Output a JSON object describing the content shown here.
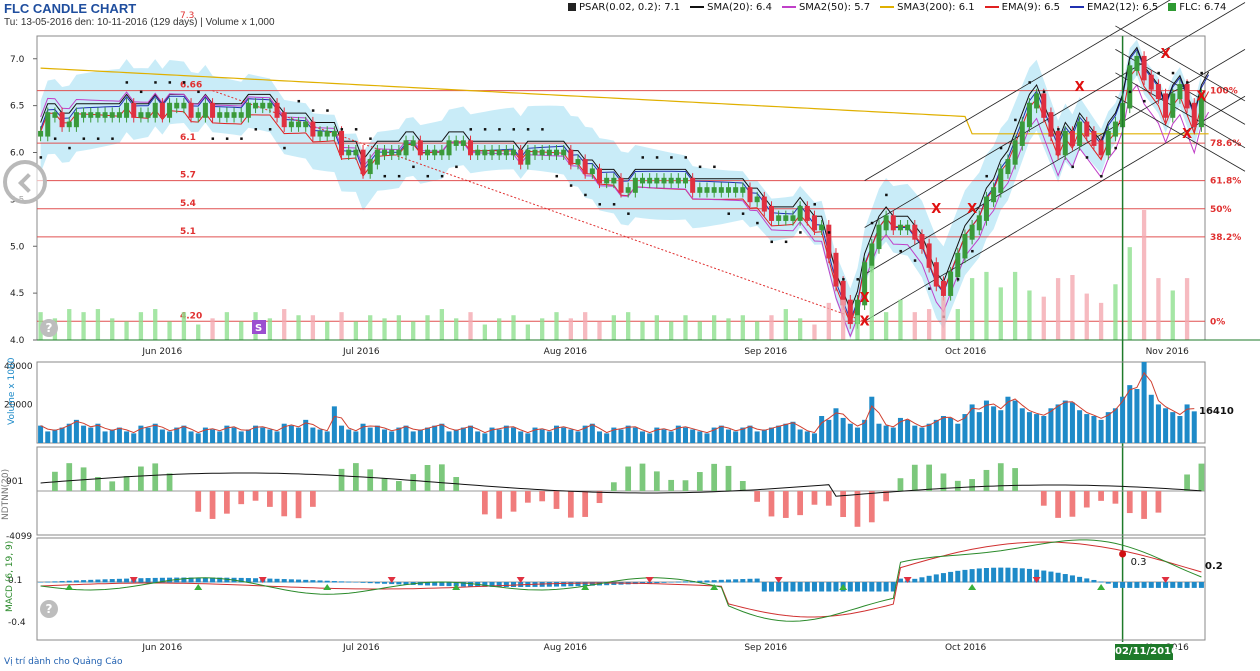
{
  "header": {
    "title": "FLC CANDLE CHART",
    "subtitle": "Tu: 13-05-2016 den: 10-11-2016 (129 days) | Volume x 1,000"
  },
  "legend": [
    {
      "label": "PSAR(0.02, 0.2): 7.1",
      "color": "#222222"
    },
    {
      "label": "SMA(20): 6.4",
      "color": "#111111"
    },
    {
      "label": "SMA2(50): 5.7",
      "color": "#c040c8"
    },
    {
      "label": "SMA3(200): 6.1",
      "color": "#e0b000"
    },
    {
      "label": "EMA(9): 6.5",
      "color": "#e02020"
    },
    {
      "label": "EMA2(12): 6.5",
      "color": "#2030b0"
    },
    {
      "label": "FLC: 6.74",
      "color": "#2e9a32"
    }
  ],
  "footer": "Vị trí dành cho Quảng Cáo",
  "cursor_date": "02/11/2016",
  "icons": {
    "nav": "chevron-left-icon",
    "help": "help-icon",
    "signal": "S"
  },
  "colors": {
    "up": "#3a9a3a",
    "down": "#e03040",
    "cloud": "#bfe9f7",
    "volume": "#1e8ac8"
  },
  "chart_data": [
    {
      "type": "candlestick",
      "title": "FLC CANDLE CHART",
      "ylim": [
        4.0,
        7.2
      ],
      "yticks": [
        "7.0",
        "6.5",
        "6.0",
        "5.5",
        "5.0",
        "4.5",
        "4.0"
      ],
      "xticks": [
        "Jun 2016",
        "Jul 2016",
        "Aug 2016",
        "Sep 2016",
        "Oct 2016",
        "Nov 2016"
      ],
      "xtick_index": [
        17,
        45,
        73,
        101,
        129,
        157
      ],
      "n": 163,
      "close": [
        6.2,
        6.4,
        6.4,
        6.3,
        6.3,
        6.4,
        6.4,
        6.4,
        6.4,
        6.4,
        6.4,
        6.4,
        6.5,
        6.4,
        6.4,
        6.4,
        6.5,
        6.4,
        6.5,
        6.5,
        6.5,
        6.4,
        6.4,
        6.5,
        6.4,
        6.4,
        6.4,
        6.4,
        6.4,
        6.5,
        6.5,
        6.5,
        6.5,
        6.4,
        6.3,
        6.3,
        6.3,
        6.3,
        6.2,
        6.2,
        6.2,
        6.2,
        6.0,
        6.0,
        6.0,
        5.8,
        5.9,
        6.0,
        6.0,
        6.0,
        6.0,
        6.1,
        6.1,
        6.0,
        6.0,
        6.0,
        6.0,
        6.1,
        6.1,
        6.1,
        6.0,
        6.0,
        6.0,
        6.0,
        6.0,
        6.0,
        6.0,
        5.9,
        6.0,
        6.0,
        6.0,
        6.0,
        6.0,
        6.0,
        5.9,
        5.9,
        5.8,
        5.8,
        5.7,
        5.7,
        5.7,
        5.6,
        5.6,
        5.7,
        5.7,
        5.7,
        5.7,
        5.7,
        5.7,
        5.7,
        5.7,
        5.6,
        5.6,
        5.6,
        5.6,
        5.6,
        5.6,
        5.6,
        5.6,
        5.5,
        5.5,
        5.4,
        5.3,
        5.3,
        5.3,
        5.3,
        5.4,
        5.3,
        5.2,
        5.2,
        4.9,
        4.6,
        4.4,
        4.2,
        4.4,
        4.8,
        5.0,
        5.2,
        5.3,
        5.2,
        5.2,
        5.2,
        5.1,
        5.0,
        4.8,
        4.6,
        4.5,
        4.7,
        4.9,
        5.1,
        5.2,
        5.3,
        5.5,
        5.6,
        5.8,
        5.9,
        6.1,
        6.3,
        6.5,
        6.6,
        6.4,
        6.2,
        6.0,
        6.2,
        6.1,
        6.3,
        6.2,
        6.1,
        6.0,
        6.2,
        6.3,
        6.5,
        6.9,
        7.0,
        6.8,
        6.7,
        6.6,
        6.4,
        6.6,
        6.7,
        6.5,
        6.3,
        6.6,
        6.74
      ],
      "levels": [
        {
          "label": "6.66",
          "pct": "100%",
          "value": 6.66
        },
        {
          "label": "6.1",
          "pct": "78.6%",
          "value": 6.1
        },
        {
          "label": "5.7",
          "pct": "61.8%",
          "value": 5.7
        },
        {
          "label": "5.4",
          "pct": "50%",
          "value": 5.4
        },
        {
          "label": "5.1",
          "pct": "38.2%",
          "value": 5.1
        },
        {
          "label": "4.20",
          "pct": "0%",
          "value": 4.2
        }
      ],
      "top_label": "7.3",
      "sma200": 6.1,
      "psar": 7.1
    },
    {
      "type": "bar",
      "title": "",
      "ylabel": "Volume x 1000",
      "yticks": [
        "40000",
        "20000"
      ],
      "ylim": [
        0,
        42000
      ],
      "last_label": "16410",
      "values": [
        9000,
        6000,
        7000,
        8000,
        10000,
        12000,
        9000,
        8000,
        10000,
        6000,
        7000,
        8000,
        6000,
        5000,
        9000,
        8000,
        10000,
        7000,
        6000,
        8000,
        9000,
        6000,
        5000,
        8000,
        7000,
        6000,
        9000,
        8000,
        6000,
        7000,
        9000,
        8000,
        7000,
        6000,
        10000,
        9000,
        8000,
        12000,
        8000,
        7000,
        6000,
        19000,
        9000,
        7000,
        6000,
        10000,
        8000,
        9000,
        7000,
        6000,
        8000,
        9000,
        6000,
        7000,
        8000,
        9000,
        10000,
        6000,
        7000,
        8000,
        9000,
        6000,
        5000,
        8000,
        7000,
        9000,
        8000,
        6000,
        5000,
        8000,
        7000,
        6000,
        9000,
        8000,
        7000,
        6000,
        9000,
        10000,
        6000,
        5000,
        8000,
        7000,
        9000,
        8000,
        6000,
        5000,
        8000,
        7000,
        6000,
        9000,
        8000,
        7000,
        6000,
        5000,
        8000,
        9000,
        7000,
        6000,
        8000,
        9000,
        6000,
        7000,
        8000,
        9000,
        10000,
        11000,
        7000,
        6000,
        5000,
        14000,
        12000,
        18000,
        13000,
        10000,
        8000,
        12000,
        24000,
        10000,
        9000,
        8000,
        13000,
        12000,
        9000,
        8000,
        10000,
        12000,
        14000,
        13000,
        10000,
        15000,
        20000,
        16000,
        22000,
        19000,
        17000,
        24000,
        22000,
        18000,
        16000,
        15000,
        14000,
        18000,
        20000,
        22000,
        21000,
        17000,
        15000,
        14000,
        12000,
        16000,
        18000,
        24000,
        30000,
        28000,
        42000,
        25000,
        20000,
        18000,
        16000,
        14000,
        20000,
        16410
      ],
      "avg": 12000
    },
    {
      "type": "bar",
      "title": "",
      "ylabel": "NDTNN(20)",
      "yticks": [
        "901",
        "-4099"
      ],
      "ylim": [
        -4600,
        3800
      ],
      "values": [
        0,
        0,
        0,
        0,
        0,
        0,
        0,
        0,
        0,
        0,
        0,
        0,
        0,
        0,
        0,
        0,
        0,
        0,
        0,
        0,
        0,
        0,
        0,
        0,
        0,
        0,
        0,
        0,
        0,
        0,
        0,
        0,
        0,
        0,
        0,
        0,
        0,
        0,
        0,
        0,
        0,
        0,
        0,
        0,
        0,
        0,
        0,
        0,
        0,
        0,
        0,
        0,
        0,
        0,
        0,
        0,
        0,
        0,
        0,
        0,
        0,
        0,
        0,
        0,
        0,
        0,
        0,
        0,
        0,
        0,
        0,
        0,
        0,
        0,
        0,
        0,
        0,
        0,
        0,
        0,
        0,
        0,
        0,
        0,
        0,
        0,
        0,
        0,
        0,
        0,
        0,
        0,
        0,
        0,
        0,
        0,
        0,
        0,
        0,
        0,
        0,
        0,
        0,
        0,
        0,
        0,
        0,
        0,
        0,
        0,
        0,
        0,
        0,
        0,
        0,
        0,
        0,
        0,
        0,
        0,
        0,
        0,
        0,
        0,
        0,
        0,
        0,
        0,
        0,
        0,
        0,
        0,
        0,
        0,
        0,
        0,
        0,
        0,
        0,
        0,
        0,
        0,
        0,
        0,
        0,
        0,
        0,
        0,
        0,
        0,
        0,
        0,
        0,
        0,
        0,
        0,
        0,
        0,
        0,
        0,
        0,
        0,
        0
      ],
      "note": "values shown as green/red bars around zero line"
    },
    {
      "type": "bar",
      "title": "",
      "ylabel": "MACD (6, 19, 9)",
      "yticks": [
        "0.1",
        "-0.4"
      ],
      "ylim": [
        -0.45,
        0.45
      ],
      "labels": [
        "0.3",
        "0.2"
      ]
    }
  ]
}
